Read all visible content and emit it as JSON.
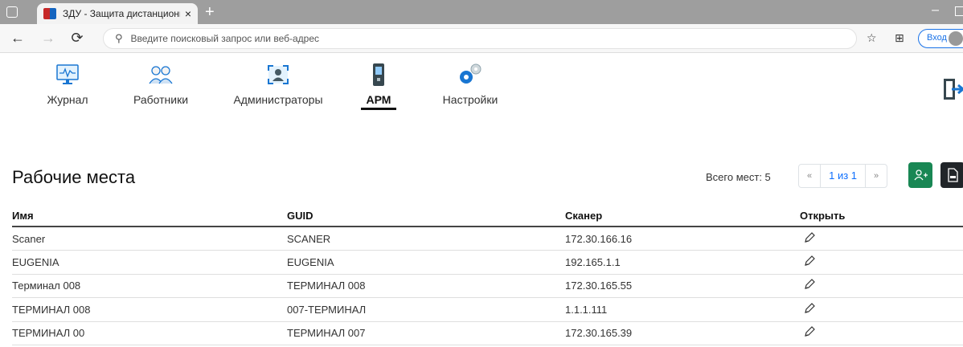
{
  "browser": {
    "tab_title": "ЗДУ - Защита дистанционного",
    "tab_close": "×",
    "new_tab": "+",
    "address_placeholder": "Введите поисковый запрос или веб-адрес",
    "login_label": "Вход"
  },
  "nav": {
    "items": [
      {
        "label": "Журнал",
        "icon": "monitor-icon"
      },
      {
        "label": "Работники",
        "icon": "users-icon"
      },
      {
        "label": "Администраторы",
        "icon": "admin-scan-icon"
      },
      {
        "label": "АРМ",
        "icon": "workstation-icon",
        "active": true
      },
      {
        "label": "Настройки",
        "icon": "gear-icon"
      }
    ],
    "exit_icon": "exit-icon"
  },
  "page": {
    "title": "Рабочие места",
    "total": "Всего мест: 5",
    "pager": {
      "prev": "«",
      "current": "1 из 1",
      "next": "»"
    }
  },
  "table": {
    "columns": [
      "Имя",
      "GUID",
      "Сканер",
      "Открыть"
    ],
    "rows": [
      {
        "name": "Scaner",
        "guid": "SCANER",
        "scanner": "172.30.166.16"
      },
      {
        "name": "EUGENIA",
        "guid": "EUGENIA",
        "scanner": "192.165.1.1"
      },
      {
        "name": "Терминал 008",
        "guid": "ТЕРМИНАЛ 008",
        "scanner": "172.30.165.55"
      },
      {
        "name": "ТЕРМИНАЛ 008",
        "guid": "007-ТЕРМИНАЛ",
        "scanner": "1.1.1.111"
      },
      {
        "name": "ТЕРМИНАЛ 00",
        "guid": "ТЕРМИНАЛ 007",
        "scanner": "172.30.165.39"
      }
    ]
  },
  "colors": {
    "add_button": "#198754",
    "export_button": "#212529",
    "link": "#0d6efd"
  }
}
